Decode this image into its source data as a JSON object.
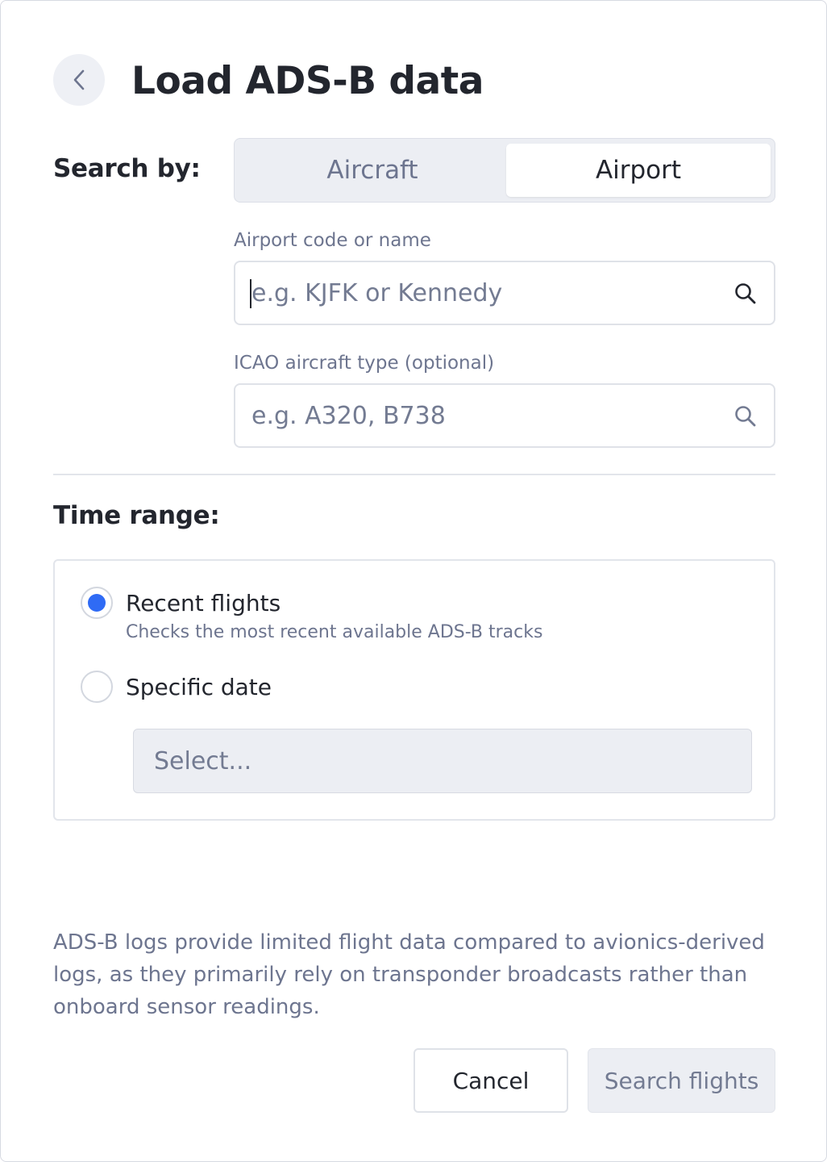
{
  "header": {
    "title": "Load ADS-B data",
    "back_icon": "chevron-left-icon"
  },
  "search_by": {
    "label": "Search by:",
    "segments": [
      {
        "label": "Aircraft",
        "selected": false
      },
      {
        "label": "Airport",
        "selected": true
      }
    ]
  },
  "airport_field": {
    "label": "Airport code or name",
    "value": "",
    "placeholder": "e.g. KJFK or Kennedy",
    "icon": "search-icon",
    "focused": true
  },
  "aircraft_type_field": {
    "label": "ICAO aircraft type (optional)",
    "value": "",
    "placeholder": "e.g. A320, B738",
    "icon": "search-icon"
  },
  "time_range": {
    "label": "Time range:",
    "options": [
      {
        "label": "Recent flights",
        "description": "Checks the most recent available ADS-B tracks",
        "selected": true
      },
      {
        "label": "Specific date",
        "selected": false
      }
    ],
    "date_select": {
      "placeholder": "Select..."
    }
  },
  "disclaimer": "ADS-B logs provide limited flight data compared to avionics-derived logs, as they primarily rely on transponder broadcasts rather than onboard sensor readings.",
  "footer": {
    "cancel_label": "Cancel",
    "submit_label": "Search flights"
  },
  "colors": {
    "accent": "#2f6bf5",
    "text_primary": "#23262e",
    "text_secondary": "#6d758f",
    "muted_bg": "#eceef3",
    "border": "#dfe2e8"
  }
}
